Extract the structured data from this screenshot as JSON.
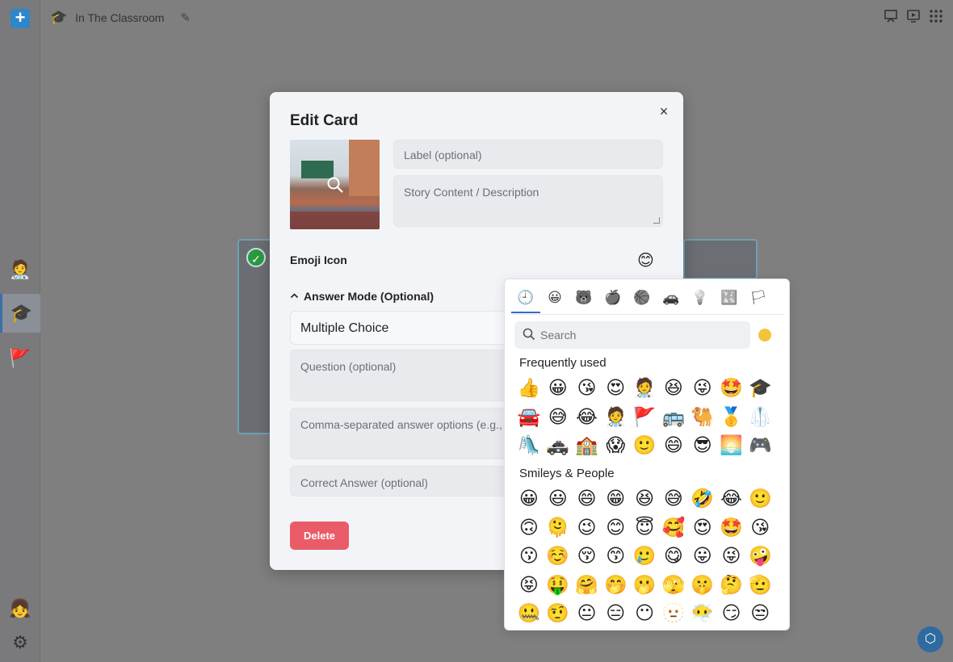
{
  "app": {
    "title": "In The Classroom",
    "add_label": "+"
  },
  "sidebar": {
    "items": [
      {
        "icon": "🧑‍⚕️",
        "name": "sidebar-item-doctor"
      },
      {
        "icon": "🎓",
        "name": "sidebar-item-classroom"
      },
      {
        "icon": "🚩",
        "name": "sidebar-item-flag"
      }
    ],
    "avatar": "👧",
    "settings": "⚙"
  },
  "modal": {
    "title": "Edit Card",
    "close": "×",
    "label_placeholder": "Label (optional)",
    "story_placeholder": "Story Content / Description",
    "emoji_icon_label": "Emoji Icon",
    "emoji_icon_value": "😊",
    "answer_mode_label": "Answer Mode (Optional)",
    "answer_mode_value": "Multiple Choice",
    "question_placeholder": "Question (optional)",
    "options_placeholder": "Comma-separated answer options (e.g., Y",
    "correct_placeholder": "Correct Answer (optional)",
    "delete_label": "Delete"
  },
  "picker": {
    "categories": [
      "🕘",
      "😀",
      "🐻",
      "🍎",
      "🏀",
      "🚗",
      "💡",
      "🔣",
      "🏳"
    ],
    "search_placeholder": "Search",
    "frequent_title": "Frequently used",
    "frequent": [
      "👍",
      "😀",
      "😘",
      "😍",
      "🧑‍⚕️",
      "😆",
      "😜",
      "🤩",
      "🎓",
      "🚘",
      "😅",
      "😂",
      "🧑‍⚕️",
      "🚩",
      "🚌",
      "🐫",
      "🥇",
      "🥼",
      "🛝",
      "🚓",
      "🏫",
      "😱",
      "🙂",
      "😄",
      "😎",
      "🌅",
      "🎮"
    ],
    "smileys_title": "Smileys & People",
    "smileys": [
      "😀",
      "😃",
      "😄",
      "😁",
      "😆",
      "😅",
      "🤣",
      "😂",
      "🙂",
      "🙃",
      "🫠",
      "😉",
      "😊",
      "😇",
      "🥰",
      "😍",
      "🤩",
      "😘",
      "😗",
      "☺️",
      "😚",
      "😙",
      "🥲",
      "😋",
      "😛",
      "😜",
      "🤪",
      "😝",
      "🤑",
      "🤗",
      "🤭",
      "🫢",
      "🫣",
      "🤫",
      "🤔",
      "🫡",
      "🤐",
      "🤨",
      "😐",
      "😑",
      "😶",
      "🫥",
      "😶‍🌫️",
      "😏",
      "😒"
    ]
  }
}
